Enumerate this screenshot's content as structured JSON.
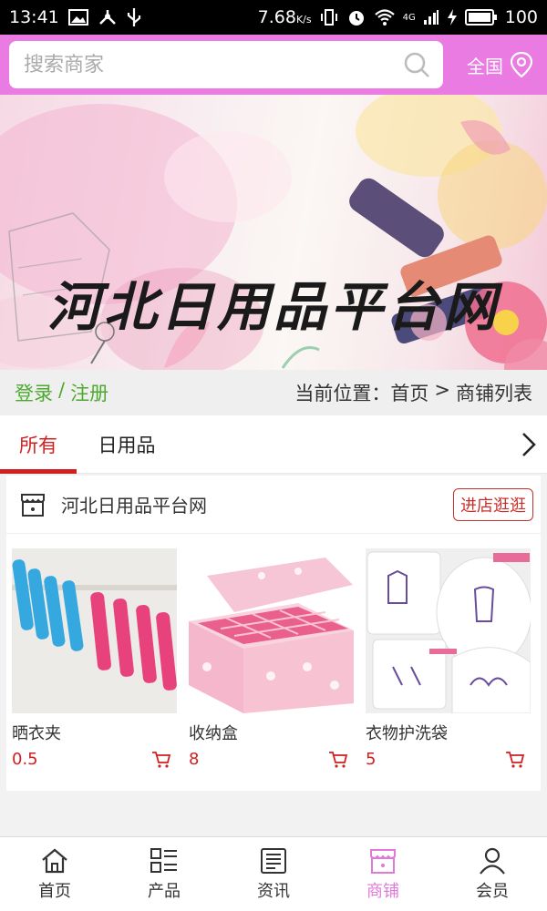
{
  "status_bar": {
    "time": "13:41",
    "speed": "7.68",
    "speed_unit": "K/s",
    "network": "4G",
    "battery": "100"
  },
  "header": {
    "search_placeholder": "搜索商家",
    "region_label": "全国",
    "accent_color": "#e97be2"
  },
  "banner": {
    "title": "河北日用品平台网"
  },
  "breadcrumb": {
    "login": "登录",
    "sep": "/",
    "register": "注册",
    "location_prefix": "当前位置：",
    "home": "首页",
    "arrow": ">",
    "current": "商铺列表"
  },
  "tabs": [
    {
      "label": "所有",
      "active": true
    },
    {
      "label": "日用品",
      "active": false
    }
  ],
  "shop": {
    "name": "河北日用品平台网",
    "visit_label": "进店逛逛",
    "products": [
      {
        "name": "晒衣夹",
        "price": "0.5",
        "icon": "cart-icon"
      },
      {
        "name": "收纳盒",
        "price": "8",
        "icon": "cart-icon"
      },
      {
        "name": "衣物护洗袋",
        "price": "5",
        "icon": "cart-icon"
      }
    ]
  },
  "bottom_nav": [
    {
      "label": "首页",
      "icon": "home-icon",
      "active": false
    },
    {
      "label": "产品",
      "icon": "grid-list-icon",
      "active": false
    },
    {
      "label": "资讯",
      "icon": "news-icon",
      "active": false
    },
    {
      "label": "商铺",
      "icon": "store-icon",
      "active": true
    },
    {
      "label": "会员",
      "icon": "user-icon",
      "active": false
    }
  ],
  "colors": {
    "active_red": "#d11f1f",
    "login_green": "#4caa2f",
    "nav_active": "#e07ad9"
  }
}
